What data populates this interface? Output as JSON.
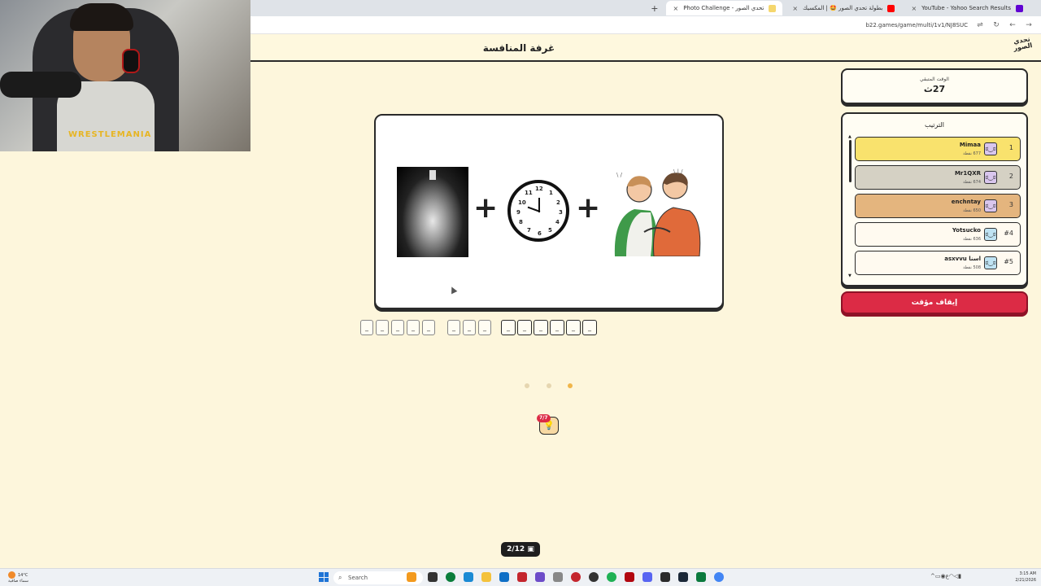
{
  "browser": {
    "tabs": [
      {
        "label": "YouTube - Yahoo Search Results",
        "favicon_color": "#6001d2"
      },
      {
        "label": "بطولة تحدي الصور 🤩 | المكسيك",
        "favicon_color": "#ff0000"
      },
      {
        "label": "Photo Challenge - تحدي الصور",
        "favicon_color": "#f5d76e"
      }
    ],
    "new_tab": "+",
    "close_glyph": "×",
    "url": "b22.games/game/multi/1v1/NJ8SUC",
    "back": "←",
    "forward": "→",
    "reload": "↻"
  },
  "header": {
    "title": "غرفة المنافسة",
    "logo_text": "تحدي الصور"
  },
  "webcam": {
    "shirt_text": "WRESTLEMANIA"
  },
  "timer": {
    "label": "الوقت المتبقي",
    "value": "27ث"
  },
  "leaderboard": {
    "title": "الترتيب",
    "avatar_glyph": "ಠ‿ಠ",
    "players": [
      {
        "rank": "1",
        "name": "Mimaa",
        "points": "677 نقطة",
        "bg": "#f9e26d",
        "avatar_bg": "#d9c6ee"
      },
      {
        "rank": "2",
        "name": "Mr1QXR",
        "points": "674 نقطة",
        "bg": "#d5d1c4",
        "avatar_bg": "#d9c6ee"
      },
      {
        "rank": "3",
        "name": "enchntay",
        "points": "650 نقطة",
        "bg": "#e4b57e",
        "avatar_bg": "#d9c6ee"
      },
      {
        "rank": "#4",
        "name": "Yotsucko",
        "points": "636 نقطة",
        "bg": "#fffaf0",
        "avatar_bg": "#bfe3f3"
      },
      {
        "rank": "#5",
        "name": "asxvvu اسنا",
        "points": "508 نقطة",
        "bg": "#fffaf0",
        "avatar_bg": "#bfe3f3"
      }
    ]
  },
  "stop_button": "إيقاف مؤقت",
  "puzzle": {
    "images": [
      "alley-image",
      "clock-image",
      "friends-image"
    ],
    "plus_glyph": "+",
    "clock_numbers": [
      "12",
      "1",
      "2",
      "3",
      "4",
      "5",
      "6",
      "7",
      "8",
      "9",
      "10",
      "11"
    ]
  },
  "answer": {
    "slot_glyph": "_",
    "groups": [
      6,
      4,
      3
    ]
  },
  "progress_dots": {
    "count": 3,
    "active_index": 2
  },
  "hint": {
    "badge": "7/7",
    "icon": "lightbulb-icon",
    "glyph": "💡"
  },
  "round": {
    "label": "2/12",
    "icon": "image-icon"
  },
  "taskbar": {
    "weather_temp": "14°C",
    "weather_desc": "سماء صافية",
    "search_placeholder": "Search",
    "time": "3:15 AM",
    "date": "2/21/2026",
    "lang": "ع",
    "app_colors": [
      "#f39a1e",
      "#0a7d3b",
      "#1a8ad4",
      "#6e3cbf",
      "#f4c23c",
      "#0f6fc6",
      "#c4262e",
      "#6d4cc9",
      "#888888",
      "#1ba160",
      "#333333",
      "#1fb155",
      "#b20710",
      "#5865f2",
      "#2b2b2b",
      "#1b2838",
      "#0b7a3e",
      "#4285f4"
    ]
  }
}
